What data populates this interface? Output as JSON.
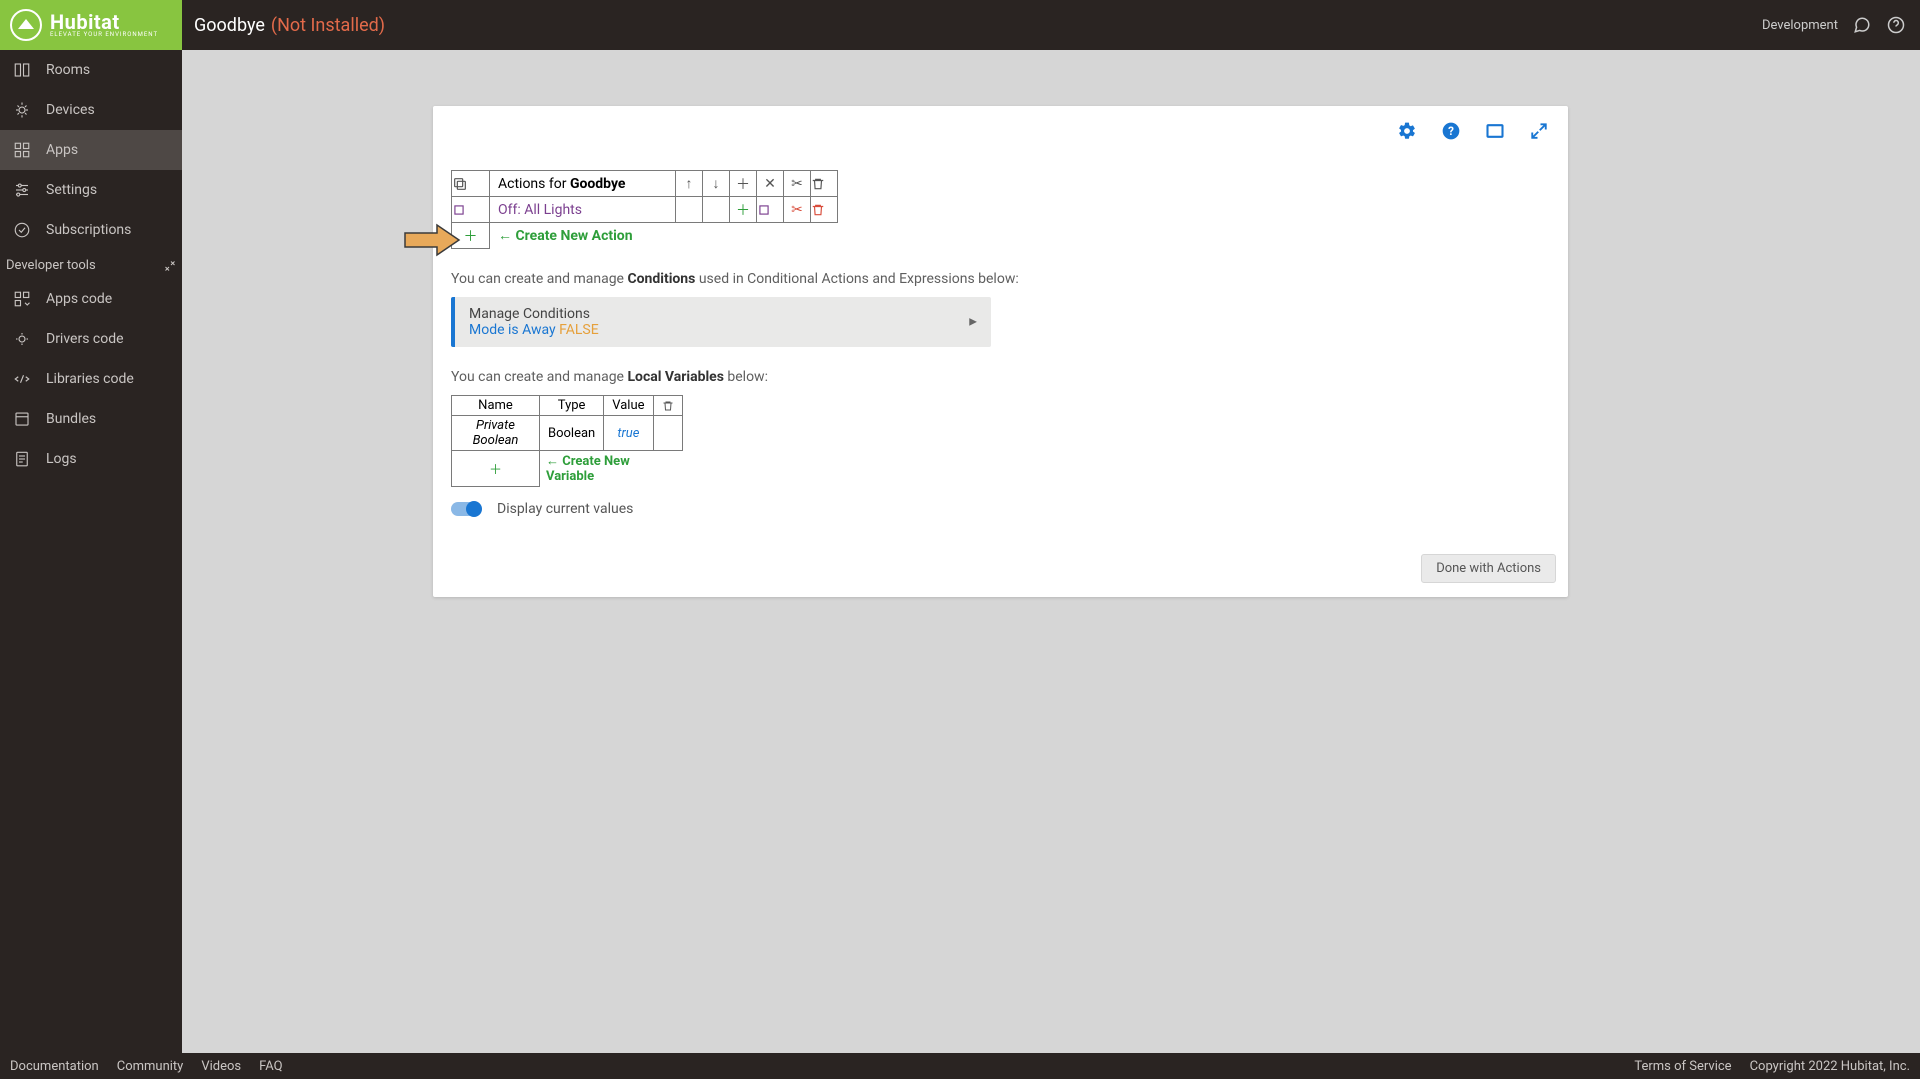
{
  "header": {
    "logo_main": "Hubitat",
    "logo_sub": "ELEVATE YOUR ENVIRONMENT",
    "title_prefix": "Goodbye",
    "title_status": "(Not Installed)",
    "dev_label": "Development"
  },
  "sidebar": {
    "items": [
      {
        "label": "Rooms"
      },
      {
        "label": "Devices"
      },
      {
        "label": "Apps"
      },
      {
        "label": "Settings"
      },
      {
        "label": "Subscriptions"
      }
    ],
    "dev_header": "Developer tools",
    "dev_items": [
      {
        "label": "Apps code"
      },
      {
        "label": "Drivers code"
      },
      {
        "label": "Libraries code"
      },
      {
        "label": "Bundles"
      },
      {
        "label": "Logs"
      }
    ]
  },
  "actions": {
    "header_prefix": "Actions for ",
    "header_name": "Goodbye",
    "rows": [
      {
        "label": "Off: All Lights"
      }
    ],
    "create_label": "← Create New Action"
  },
  "conditions": {
    "intro_pre": "You can create and manage ",
    "intro_bold": "Conditions",
    "intro_post": " used in Conditional Actions and Expressions below:",
    "box_title": "Manage Conditions",
    "mode_text": "Mode is Away ",
    "mode_state": "FALSE"
  },
  "vars": {
    "intro_pre": "You can create and manage ",
    "intro_bold": "Local Variables",
    "intro_post": " below:",
    "cols": {
      "name": "Name",
      "type": "Type",
      "value": "Value"
    },
    "rows": [
      {
        "name": "Private Boolean",
        "type": "Boolean",
        "value": "true"
      }
    ],
    "create_label": "← Create New Variable"
  },
  "toggle": {
    "label": "Display current values"
  },
  "done_btn": "Done with Actions",
  "footer": {
    "links": [
      "Documentation",
      "Community",
      "Videos",
      "FAQ"
    ],
    "terms": "Terms of Service",
    "copyright": "Copyright 2022 Hubitat, Inc."
  }
}
